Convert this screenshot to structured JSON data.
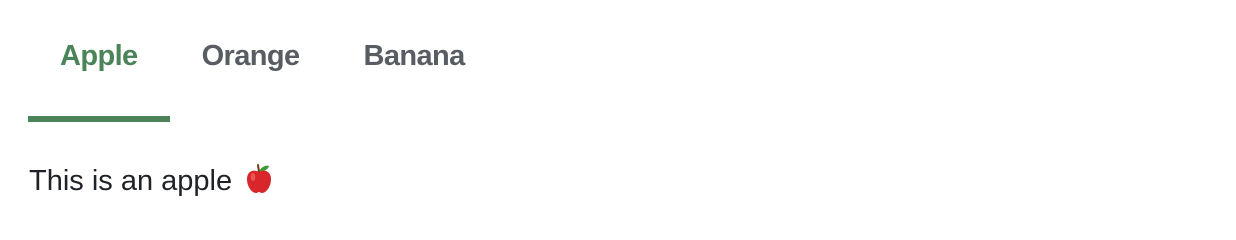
{
  "tabs": [
    {
      "label": "Apple",
      "active": true
    },
    {
      "label": "Orange",
      "active": false
    },
    {
      "label": "Banana",
      "active": false
    }
  ],
  "panel": {
    "text": "This is an apple",
    "icon": "red-apple-icon"
  },
  "colors": {
    "accent": "#4a8458",
    "tab_inactive": "#585c63",
    "body_text": "#1f2226",
    "apple_red": "#d9262b"
  }
}
